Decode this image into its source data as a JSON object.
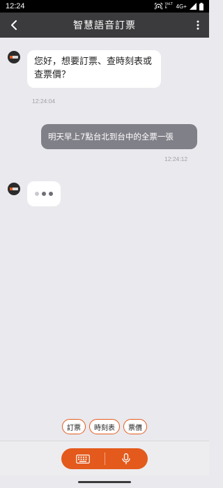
{
  "status_bar": {
    "time": "12:24",
    "network": "4G+",
    "volte": "VoLTE"
  },
  "app_bar": {
    "title": "智慧語音訂票",
    "back_icon": "chevron-left-icon",
    "more_icon": "more-vertical-icon"
  },
  "chat": {
    "messages": [
      {
        "sender": "bot",
        "text": "您好，想要訂票、查時刻表或查票價？",
        "time": "12:24:04"
      },
      {
        "sender": "user",
        "text": "明天早上7點台北到台中的全票一張",
        "time": "12:24:12"
      },
      {
        "sender": "bot",
        "typing": true
      }
    ]
  },
  "quick_replies": [
    "訂票",
    "時刻表",
    "票價"
  ],
  "input_bar": {
    "keyboard_icon": "keyboard-icon",
    "mic_icon": "microphone-icon"
  },
  "colors": {
    "accent": "#e35a1c",
    "app_bar": "#3b3b3d",
    "background": "#e9e9ee",
    "user_bubble": "#808088",
    "typing_dot_light": "#c9c9cf",
    "typing_dot_dark": "#6e6e75"
  }
}
